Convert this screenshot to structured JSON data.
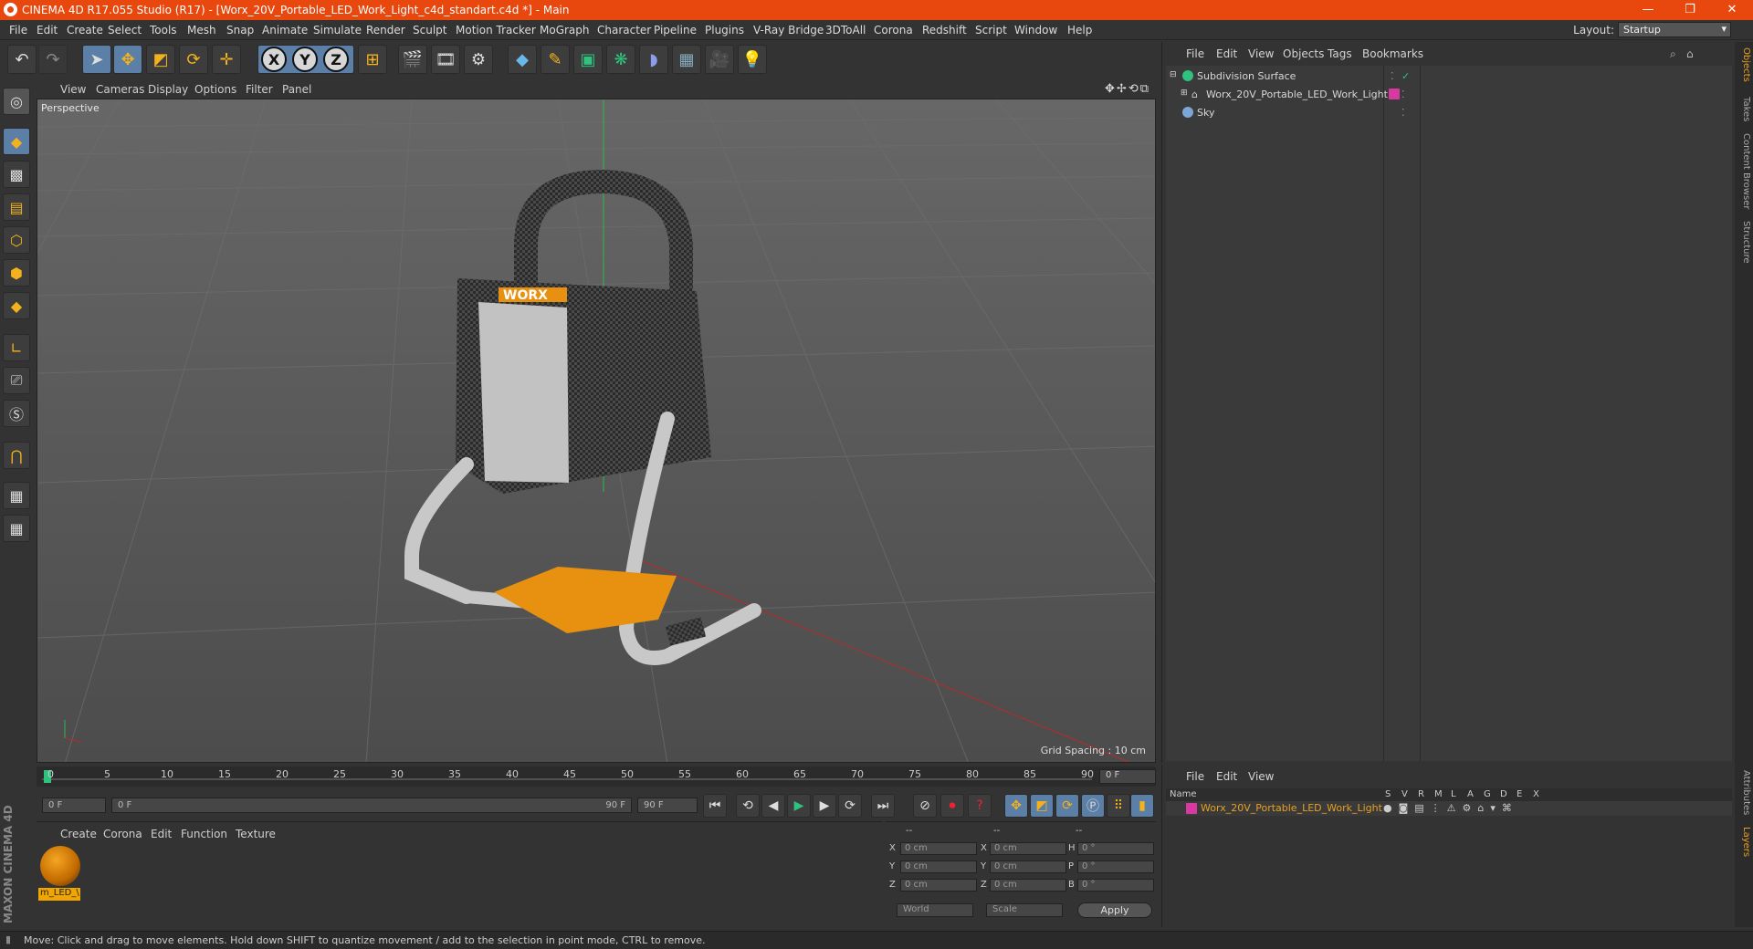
{
  "window": {
    "title": "CINEMA 4D R17.055 Studio (R17) - [Worx_20V_Portable_LED_Work_Light_c4d_standart.c4d *] - Main",
    "minimize": "—",
    "maximize": "❐",
    "close": "✕"
  },
  "menu": [
    "File",
    "Edit",
    "Create",
    "Select",
    "Tools",
    "Mesh",
    "Snap",
    "Animate",
    "Simulate",
    "Render",
    "Sculpt",
    "Motion Tracker",
    "MoGraph",
    "Character",
    "Pipeline",
    "Plugins",
    "V-Ray Bridge",
    "3DToAll",
    "Corona",
    "Redshift",
    "Script",
    "Window",
    "Help"
  ],
  "layout": {
    "label": "Layout:",
    "value": "Startup"
  },
  "viewport": {
    "menu": [
      "View",
      "Cameras",
      "Display",
      "Options",
      "Filter",
      "Panel"
    ],
    "label": "Perspective",
    "grid_spacing": "Grid Spacing : 10 cm",
    "nav_icons": "✥✢⟲⧉",
    "brand_text": "WORX"
  },
  "timeline": {
    "ticks": [
      "0",
      "5",
      "10",
      "15",
      "20",
      "25",
      "30",
      "35",
      "40",
      "45",
      "50",
      "55",
      "60",
      "65",
      "70",
      "75",
      "80",
      "85",
      "90"
    ],
    "current_frame": "0 F",
    "start": "0 F",
    "range_start": "0 F",
    "range_end": "90 F",
    "end": "90 F"
  },
  "materials": {
    "menu": [
      "Create",
      "Corona",
      "Edit",
      "Function",
      "Texture"
    ],
    "items": [
      {
        "name": "m_LED_\\"
      }
    ]
  },
  "coordinates": {
    "headers": [
      "--",
      "--",
      "--"
    ],
    "rows": [
      {
        "a": "X",
        "av": "0 cm",
        "b": "X",
        "bv": "0 cm",
        "c": "H",
        "cv": "0 °"
      },
      {
        "a": "Y",
        "av": "0 cm",
        "b": "Y",
        "bv": "0 cm",
        "c": "P",
        "cv": "0 °"
      },
      {
        "a": "Z",
        "av": "0 cm",
        "b": "Z",
        "bv": "0 cm",
        "c": "B",
        "cv": "0 °"
      }
    ],
    "space": "World",
    "mode": "Scale",
    "apply": "Apply"
  },
  "objects": {
    "menu": [
      "File",
      "Edit",
      "View",
      "Objects",
      "Tags",
      "Bookmarks"
    ],
    "items": [
      {
        "name": "Subdivision Surface",
        "color": "#2ec27e"
      },
      {
        "name": "Worx_20V_Portable_LED_Work_Light",
        "color": "#9aa3ad"
      },
      {
        "name": "Sky",
        "color": "#7aa7d6"
      }
    ]
  },
  "layers": {
    "menu": [
      "File",
      "Edit",
      "View"
    ],
    "header_name": "Name",
    "columns": [
      "S",
      "V",
      "R",
      "M",
      "L",
      "A",
      "G",
      "D",
      "E",
      "X"
    ],
    "items": [
      {
        "name": "Worx_20V_Portable_LED_Work_Light",
        "color": "#d63aa0"
      }
    ]
  },
  "side_tabs": [
    "Objects",
    "Takes",
    "Content Browser",
    "Structure"
  ],
  "side_tabs_lower": [
    "Attributes",
    "Layers"
  ],
  "brand": "MAXON CINEMA 4D",
  "status": "Move: Click and drag to move elements. Hold down SHIFT to quantize movement / add to the selection in point mode, CTRL to remove.",
  "colors": {
    "accent": "#e8470e",
    "selection": "#5b7fa6",
    "material": "#f0a500"
  }
}
